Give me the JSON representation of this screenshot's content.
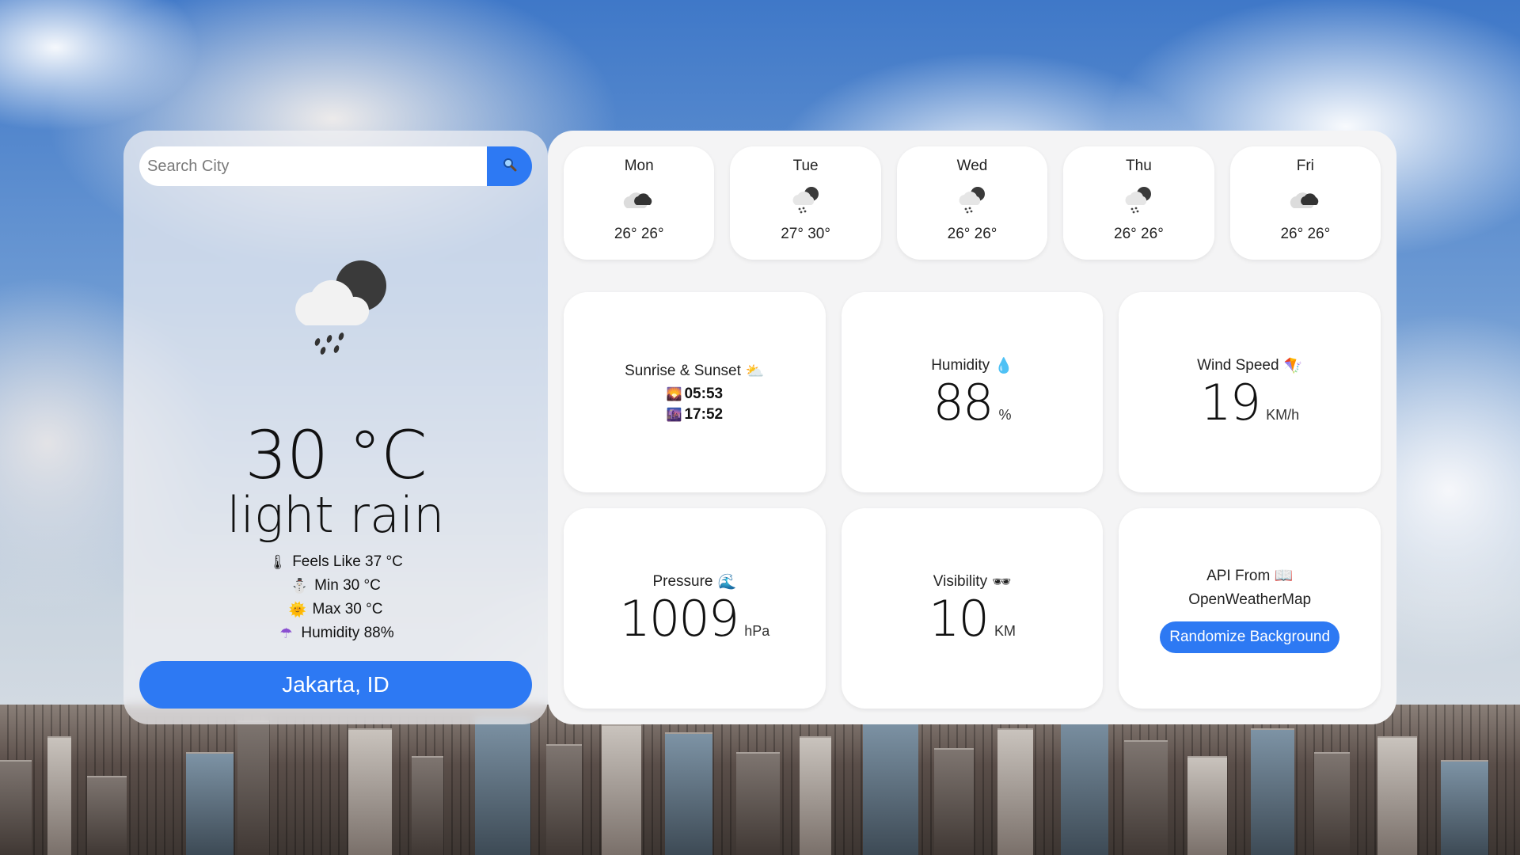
{
  "search": {
    "placeholder": "Search City",
    "button_icon": "search-icon"
  },
  "current": {
    "icon": "rain-night-icon",
    "temperature": "30 °C",
    "description": "light rain",
    "details": [
      {
        "icon": "thermometer-icon",
        "glyph": "🌡",
        "label": "Feels Like 37 °C"
      },
      {
        "icon": "snowman-icon",
        "glyph": "⛄",
        "label": "Min 30 °C"
      },
      {
        "icon": "sun-icon",
        "glyph": "🌞",
        "label": "Max 30 °C"
      },
      {
        "icon": "umbrella-icon",
        "glyph": "☂",
        "label": "Humidity 88%"
      }
    ],
    "location": "Jakarta, ID"
  },
  "forecast": [
    {
      "day": "Mon",
      "icon": "broken-clouds-icon",
      "temps": "26° 26°"
    },
    {
      "day": "Tue",
      "icon": "rain-night-icon",
      "temps": "27° 30°"
    },
    {
      "day": "Wed",
      "icon": "rain-night-icon",
      "temps": "26° 26°"
    },
    {
      "day": "Thu",
      "icon": "rain-night-icon",
      "temps": "26° 26°"
    },
    {
      "day": "Fri",
      "icon": "broken-clouds-icon",
      "temps": "26° 26°"
    }
  ],
  "stats": {
    "sun": {
      "title": "Sunrise & Sunset",
      "title_icon": "⛅",
      "sunrise": "05:53",
      "sunrise_icon": "🌄",
      "sunset": "17:52",
      "sunset_icon": "🌆"
    },
    "humidity": {
      "title": "Humidity",
      "title_icon": "💧",
      "value": "88",
      "unit": "%"
    },
    "wind": {
      "title": "Wind Speed",
      "title_icon": "🪁",
      "value": "19",
      "unit": "KM/h"
    },
    "pressure": {
      "title": "Pressure",
      "title_icon": "🌊",
      "value": "1009",
      "unit": "hPa"
    },
    "visibility": {
      "title": "Visibility",
      "title_icon": "🕶",
      "value": "10",
      "unit": "KM"
    },
    "api": {
      "line1": "API From",
      "line1_icon": "📖",
      "line2": "OpenWeatherMap",
      "button": "Randomize Background"
    }
  },
  "colors": {
    "accent": "#2d79f3",
    "panel": "#f4f4f5"
  }
}
